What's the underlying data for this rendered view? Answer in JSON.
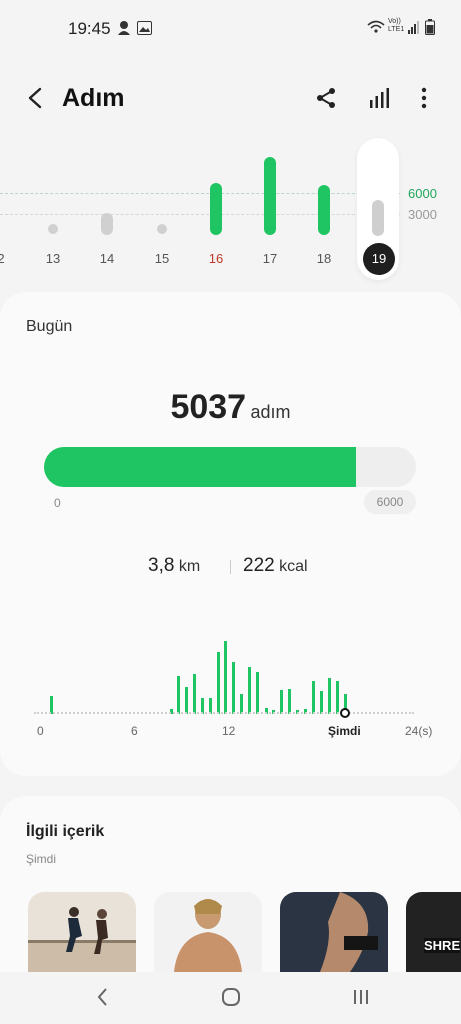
{
  "status_bar": {
    "time": "19:45",
    "network": "Vo)) LTE1"
  },
  "header": {
    "title": "Adım"
  },
  "week_chart": {
    "days": [
      {
        "label": "2",
        "status": "low"
      },
      {
        "label": "13",
        "status": "low"
      },
      {
        "label": "14",
        "status": "low"
      },
      {
        "label": "15",
        "status": "low"
      },
      {
        "label": "16",
        "status": "goal"
      },
      {
        "label": "17",
        "status": "goal"
      },
      {
        "label": "18",
        "status": "goal"
      },
      {
        "label": "19",
        "status": "selected"
      }
    ],
    "goal_label_high": "6000",
    "goal_label_low": "3000"
  },
  "today": {
    "label": "Bugün",
    "steps": "5037",
    "unit": "adım",
    "progress_fraction": 0.84,
    "progress_min": "0",
    "progress_max": "6000",
    "distance_value": "3,8",
    "distance_unit": "km",
    "calories_value": "222",
    "calories_unit": "kcal"
  },
  "hourly": {
    "axis": [
      "0",
      "6",
      "12",
      "Şimdi",
      "24(s)"
    ]
  },
  "related": {
    "title": "İlgili içerik",
    "subtitle": "Şimdi",
    "thumb3_text": "SHRE"
  },
  "colors": {
    "accent": "#20c563",
    "goal_label": "#20a85a",
    "muted": "#d0d0d0"
  }
}
